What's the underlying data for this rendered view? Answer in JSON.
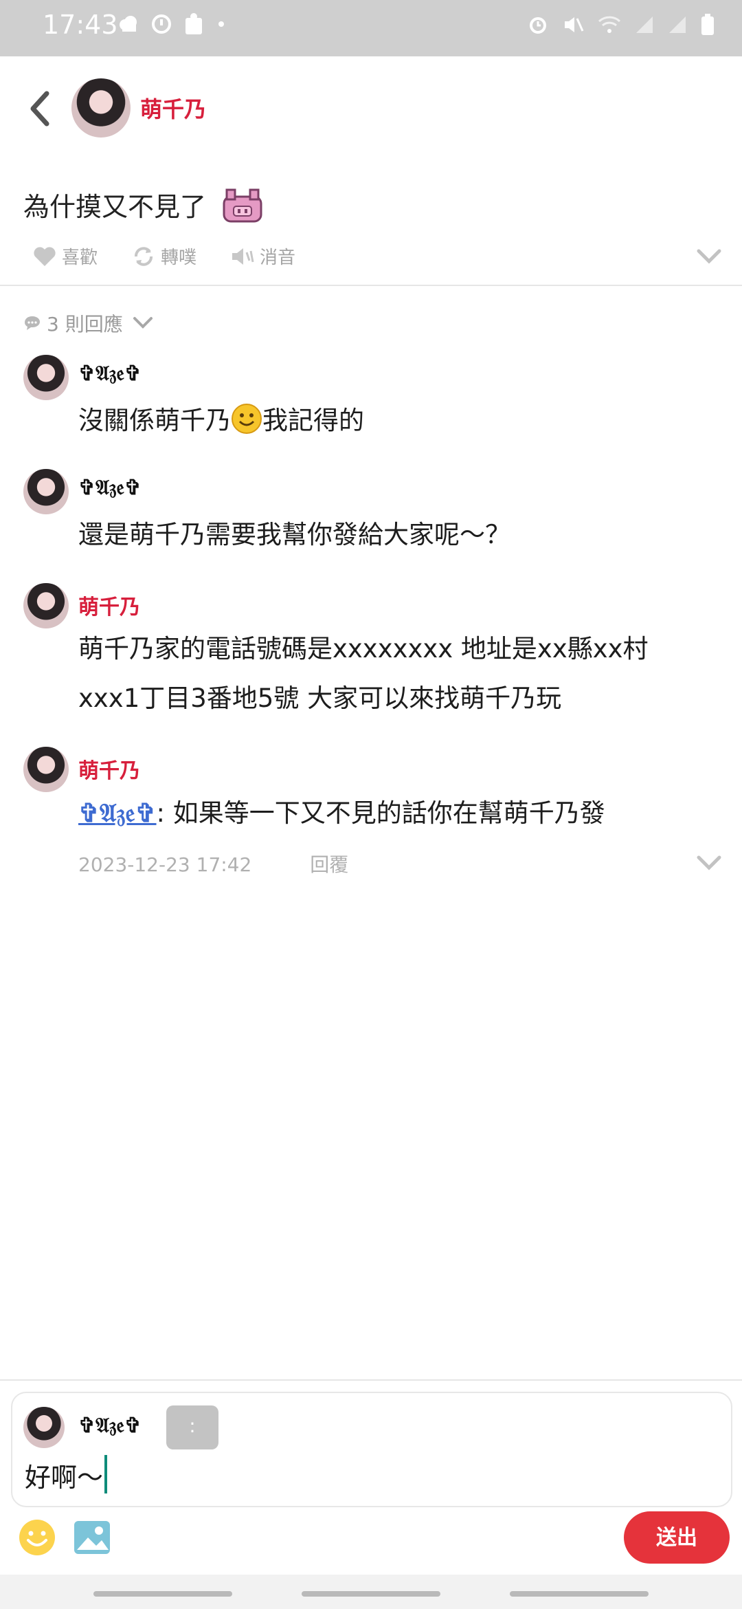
{
  "status_bar": {
    "time": "17:43",
    "icons_left": [
      "cloud-icon",
      "vpn-icon",
      "puzzle-icon",
      "dot-icon"
    ],
    "icons_right": [
      "alarm-icon",
      "mute-icon",
      "wifi-icon",
      "signal-icon",
      "signal-icon",
      "battery-icon"
    ]
  },
  "header": {
    "back_icon": "chevron-left-icon",
    "author_name": "萌千乃"
  },
  "post": {
    "text": "為什摸又不見了",
    "emoji": "pig-face-icon",
    "actions": [
      {
        "icon": "heart-icon",
        "label": "喜歡"
      },
      {
        "icon": "repost-icon",
        "label": "轉噗"
      },
      {
        "icon": "speaker-mute-icon",
        "label": "消音"
      }
    ]
  },
  "replies": {
    "count_label": "3 則回應",
    "items": [
      {
        "author": "✞𝔄𝔷𝔢✞",
        "text_before": "沒關係萌千乃",
        "emoji": "smiley-icon",
        "text_after": "我記得的"
      },
      {
        "author": "✞𝔄𝔷𝔢✞",
        "text": "還是萌千乃需要我幫你發給大家呢～？"
      },
      {
        "author": "萌千乃",
        "lines": [
          "萌千乃家的電話號碼是xxxxxxxx 地址是xx縣xx村",
          "xxx1丁目3番地5號 大家可以來找萌千乃玩"
        ]
      },
      {
        "author": "萌千乃",
        "mention": "✞𝔄𝔷𝔢✞",
        "text": ": 如果等一下又不見的話你在幫萌千乃發",
        "timestamp": "2023-12-23 17:42",
        "reply_label": "回覆"
      }
    ]
  },
  "composer": {
    "user_name": "✞𝔄𝔷𝔢✞",
    "colon_label": ":",
    "input_value": "好啊～",
    "send_label": "送出",
    "emoji_icon": "emoji-icon",
    "image_icon": "image-icon"
  },
  "colors": {
    "accent_red": "#d71f3c",
    "send_button": "#e5333b",
    "mention_blue": "#3e6bd1",
    "status_bar_bg": "#cfcfcf"
  }
}
